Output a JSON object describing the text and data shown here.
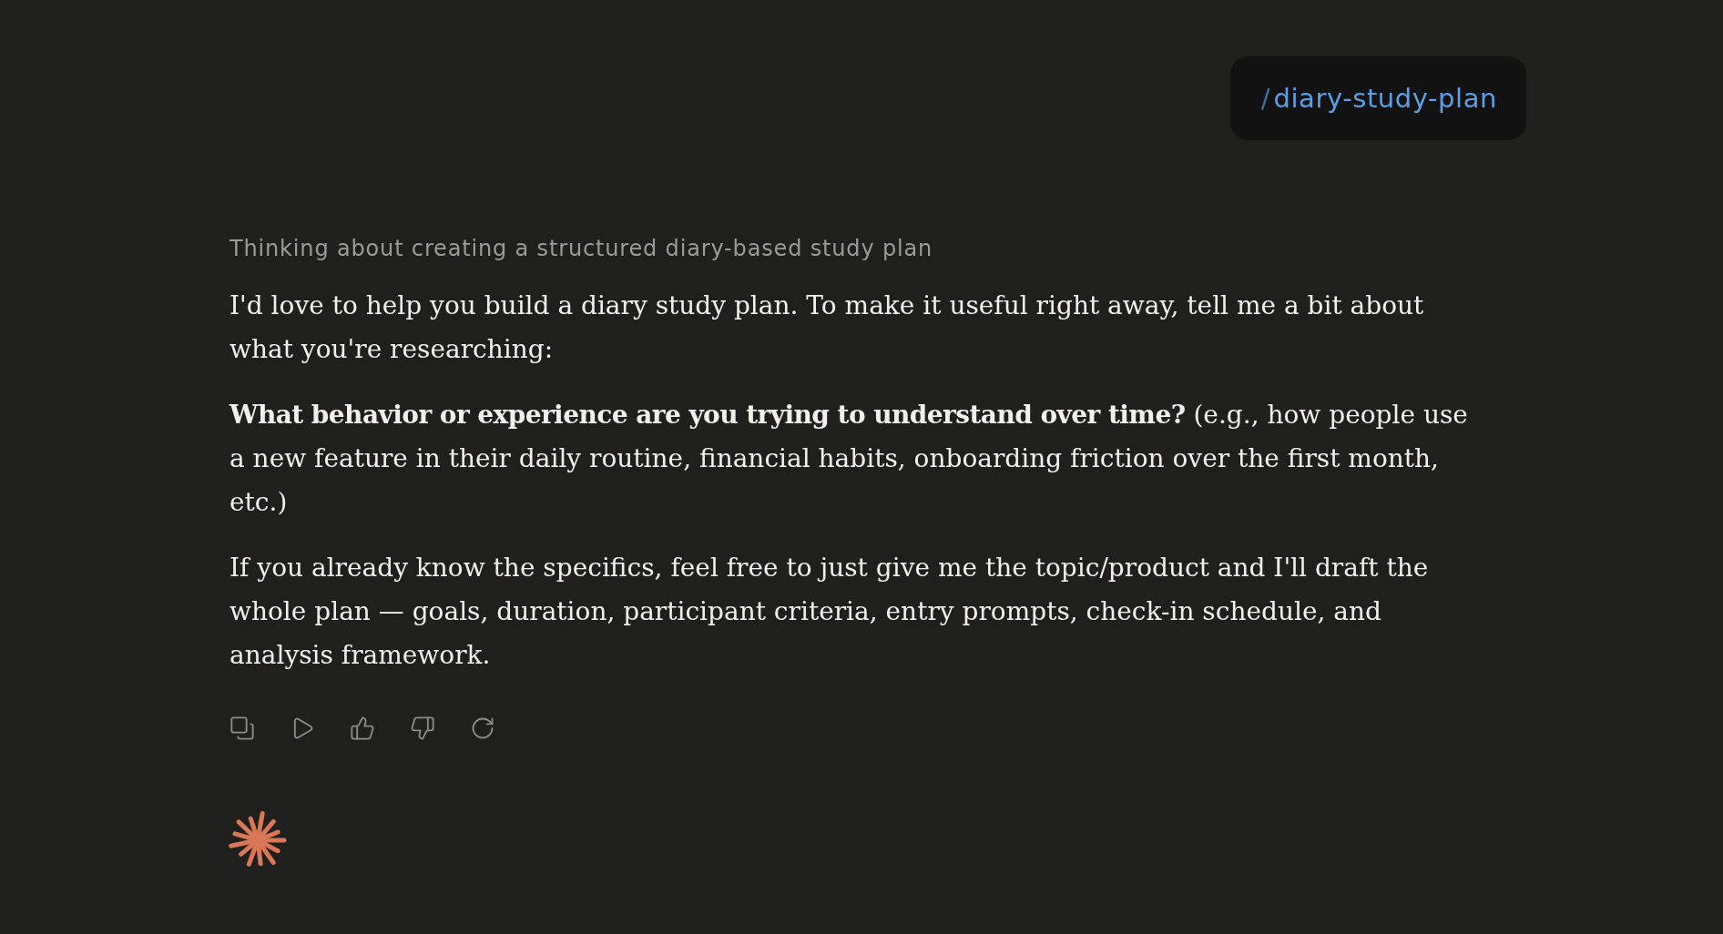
{
  "user_message": {
    "prefix": "/",
    "command": "diary-study-plan"
  },
  "thinking_label": "Thinking about creating a structured diary-based study plan",
  "response_paragraphs": [
    "I'd love to help you build a diary study plan. To make it useful right away, tell me a bit about what you're researching:",
    "**What behavior or experience are you trying to understand over time?** (e.g., how people use a new feature in their daily routine, financial habits, onboarding friction over the first month, etc.)",
    "If you already know the specifics, feel free to just give me the topic/product and I'll draft the whole plan — goals, duration, participant criteria, entry prompts, check-in schedule, and analysis framework."
  ]
}
